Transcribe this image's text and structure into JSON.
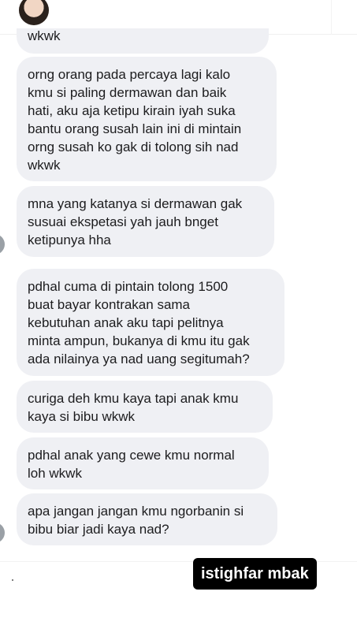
{
  "messages": [
    {
      "text": "wkwk"
    },
    {
      "text": "orng orang pada percaya lagi kalo\nkmu si paling dermawan dan baik\nhati, aku aja ketipu kirain iyah suka\nbantu orang susah lain ini di mintain\norng susah ko gak di tolong sih nad\nwkwk"
    },
    {
      "text": "mna yang katanya si dermawan gak\nsusuai ekspetasi yah jauh bnget\nketipunya hha"
    },
    {
      "text": "pdhal cuma di pintain tolong 1500\nbuat bayar kontrakan sama\nkebutuhan anak aku tapi pelitnya\nminta ampun, bukanya di kmu itu gak\nada nilainya ya nad uang segitumah?"
    },
    {
      "text": "curiga deh kmu kaya tapi anak kmu\nkaya si bibu wkwk"
    },
    {
      "text": "pdhal anak yang cewe kmu normal\nloh wkwk"
    },
    {
      "text": "apa jangan jangan kmu ngorbanin si\nbibu biar jadi kaya nad?"
    }
  ],
  "caption": {
    "text": "istighfar mbak"
  }
}
